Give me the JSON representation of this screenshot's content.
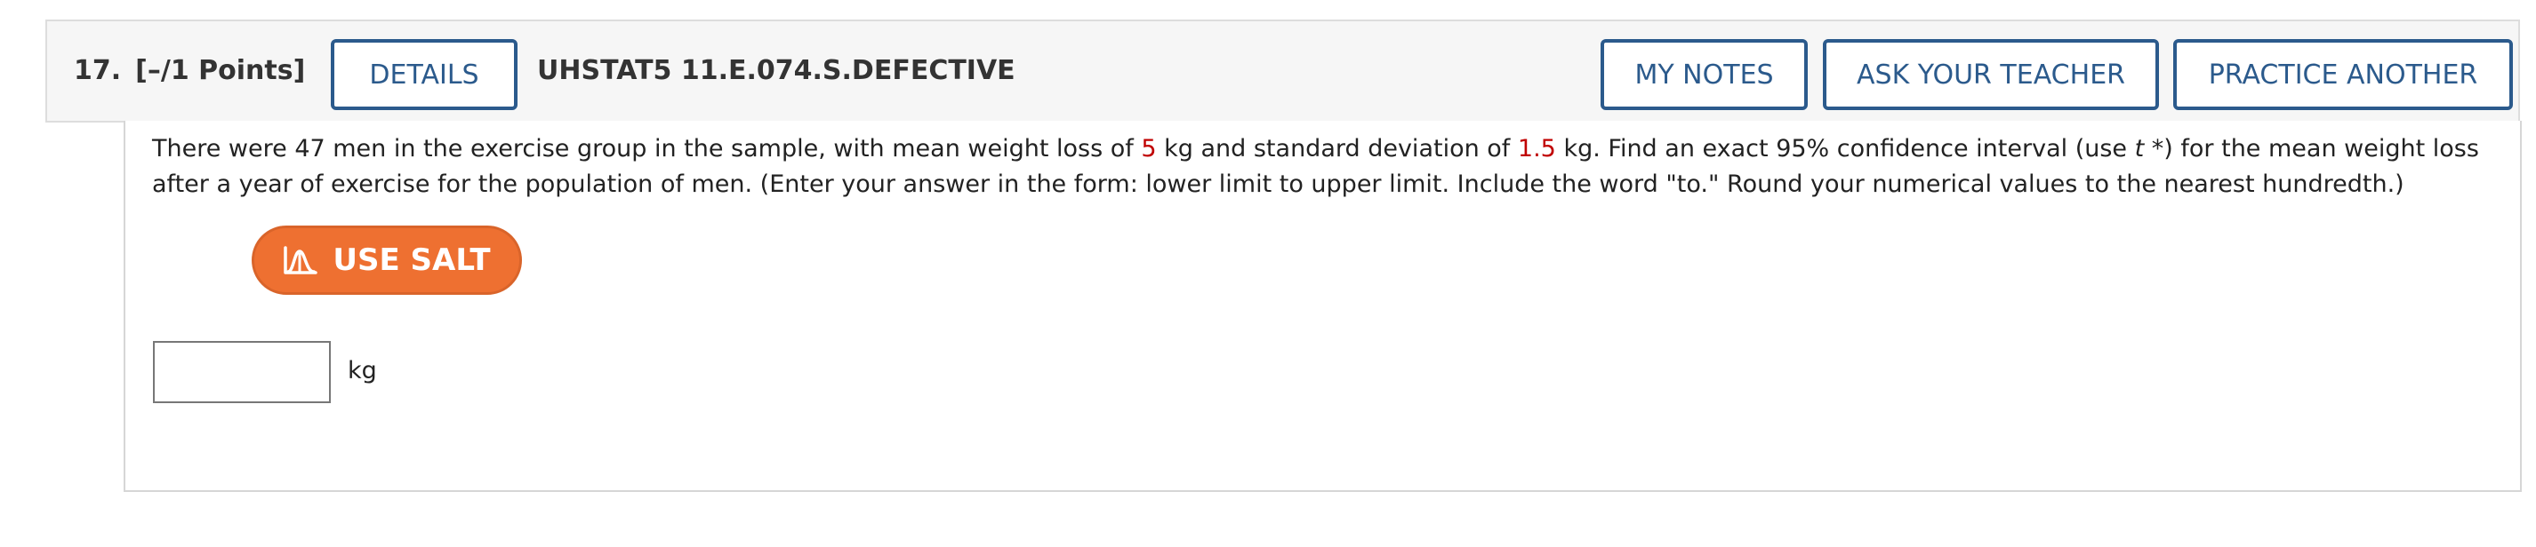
{
  "question": {
    "number": "17.",
    "points": "[–/1 Points]",
    "details_label": "DETAILS",
    "code": "UHSTAT5 11.E.074.S.DEFECTIVE",
    "my_notes_label": "MY NOTES",
    "ask_teacher_label": "ASK YOUR TEACHER",
    "practice_another_label": "PRACTICE ANOTHER"
  },
  "prompt": {
    "part1": "There were 47 men in the exercise group in the sample, with mean weight loss of ",
    "mean_value": "5",
    "part2": " kg and standard deviation of ",
    "sd_value": "1.5",
    "part3": " kg. Find an exact 95% confidence interval (use ",
    "t_symbol": "t",
    "part4": " *) for the mean weight loss after a year of exercise for the population of men. (Enter your answer in the form: lower limit to upper limit. Include the word \"to.\" Round your numerical values to the nearest hundredth.)"
  },
  "salt": {
    "label": "USE SALT",
    "icon": "salt-distribution-icon"
  },
  "answer": {
    "value": "",
    "placeholder": "",
    "unit": "kg"
  },
  "colors": {
    "header_bg": "#f6f6f6",
    "button_border": "#2b5a8c",
    "highlight_red": "#c00000",
    "salt_orange": "#ee7031"
  }
}
